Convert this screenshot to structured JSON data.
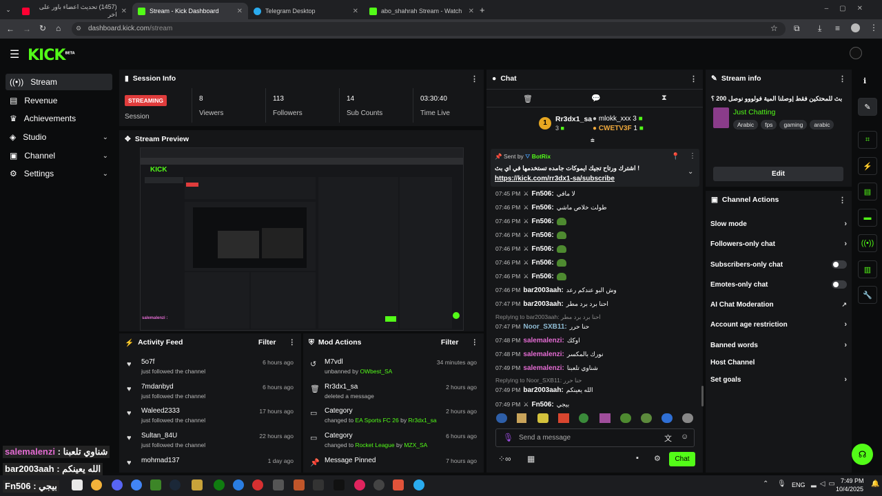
{
  "browser": {
    "tabs": [
      {
        "title": "(1457) تحديث اعضاء باور على اخر",
        "fav_color": "#ff0033"
      },
      {
        "title": "Stream - Kick Dashboard",
        "fav_color": "#53fc18"
      },
      {
        "title": "Telegram Desktop",
        "fav_color": "#2aabee"
      },
      {
        "title": "abo_shahrah Stream - Watch Li",
        "fav_color": "#53fc18"
      }
    ],
    "url_host": "dashboard.kick.com",
    "url_path": "/stream"
  },
  "header": {
    "logo": "KICK",
    "logo_badge": "BETA"
  },
  "sidebar": {
    "items": [
      {
        "label": "Stream",
        "icon": "broadcast-icon"
      },
      {
        "label": "Revenue",
        "icon": "revenue-icon"
      },
      {
        "label": "Achievements",
        "icon": "trophy-icon"
      },
      {
        "label": "Studio",
        "icon": "studio-icon"
      },
      {
        "label": "Channel",
        "icon": "channel-icon"
      },
      {
        "label": "Settings",
        "icon": "gear-icon"
      }
    ]
  },
  "session": {
    "title": "Session Info",
    "status_badge": "STREAMING",
    "status_label": "Session",
    "stats": [
      {
        "value": "8",
        "label": "Viewers"
      },
      {
        "value": "113",
        "label": "Followers"
      },
      {
        "value": "14",
        "label": "Sub Counts"
      },
      {
        "value": "03:30:40",
        "label": "Time Live"
      }
    ]
  },
  "preview": {
    "title": "Stream Preview"
  },
  "activity": {
    "title": "Activity Feed",
    "filter": "Filter",
    "items": [
      {
        "name": "5o7f",
        "desc": "just followed the channel",
        "time": "6 hours ago"
      },
      {
        "name": "7mdanbyd",
        "desc": "just followed the channel",
        "time": "6 hours ago"
      },
      {
        "name": "Waleed2333",
        "desc": "just followed the channel",
        "time": "17 hours ago"
      },
      {
        "name": "Sultan_84U",
        "desc": "just followed the channel",
        "time": "22 hours ago"
      },
      {
        "name": "mohmad137",
        "desc": "",
        "time": "1 day ago"
      }
    ]
  },
  "mod": {
    "title": "Mod Actions",
    "filter": "Filter",
    "items": [
      {
        "name": "M7vdl",
        "desc_pre": "unbanned by ",
        "desc_hl": "OWbest_SA",
        "desc_mid": "",
        "desc_hl2": "",
        "time": "34 minutes ago"
      },
      {
        "name": "Rr3dx1_sa",
        "desc_pre": "deleted a message",
        "desc_hl": "",
        "desc_mid": "",
        "desc_hl2": "",
        "time": "2 hours ago"
      },
      {
        "name": "Category",
        "desc_pre": "changed to ",
        "desc_hl": "EA Sports FC 26",
        "desc_mid": " by ",
        "desc_hl2": "Rr3dx1_sa",
        "time": "2 hours ago"
      },
      {
        "name": "Category",
        "desc_pre": "changed to ",
        "desc_hl": "Rocket League",
        "desc_mid": " by ",
        "desc_hl2": "MZX_SA",
        "time": "6 hours ago"
      },
      {
        "name": "Message Pinned",
        "desc_pre": "",
        "desc_hl": "",
        "desc_mid": "",
        "desc_hl2": "",
        "time": "7 hours ago"
      }
    ]
  },
  "chat": {
    "title": "Chat",
    "leaders": [
      {
        "rank": "1",
        "name": "Rr3dx1_sa",
        "count": "3"
      },
      {
        "name": "mlokk_xxx",
        "count": "3"
      },
      {
        "name": "CWETV3F",
        "count": "1"
      }
    ],
    "pinned": {
      "sent_by": "Sent by",
      "sender": "BotRix",
      "text": "! اشترك ورتاح تجيك ايموكات جامده تستخدمها في اي بث",
      "link": "https://kick.com/rr3dx1-sa/subscribe"
    },
    "messages": [
      {
        "time": "07:45 PM",
        "user": "Fn506:",
        "text": "لا مافي",
        "color": "#ffffff"
      },
      {
        "time": "07:46 PM",
        "user": "Fn506:",
        "text": "طولت خلاص ماشي",
        "color": "#ffffff"
      },
      {
        "time": "07:46 PM",
        "user": "Fn506:",
        "text": "",
        "color": "#ffffff",
        "emote": true
      },
      {
        "time": "07:46 PM",
        "user": "Fn506:",
        "text": "",
        "color": "#ffffff",
        "emote": true
      },
      {
        "time": "07:46 PM",
        "user": "Fn506:",
        "text": "",
        "color": "#ffffff",
        "emote": true
      },
      {
        "time": "07:46 PM",
        "user": "Fn506:",
        "text": "",
        "color": "#ffffff",
        "emote": true
      },
      {
        "time": "07:46 PM",
        "user": "Fn506:",
        "text": "",
        "color": "#ffffff",
        "emote": true
      },
      {
        "time": "07:46 PM",
        "user": "bar2003aah:",
        "text": "وش البو عندكم رعد",
        "color": "#ffffff"
      },
      {
        "time": "07:47 PM",
        "user": "bar2003aah:",
        "text": "احنا برد برد مطر",
        "color": "#ffffff"
      },
      {
        "time": "07:47 PM",
        "user": "Noor_SXB11:",
        "text": "حنا حرر",
        "color": "#8fbcd4",
        "reply": "Replying to bar2003aah: احنا برد برد مطر"
      },
      {
        "time": "07:48 PM",
        "user": "salemalenzi:",
        "text": "اوكك",
        "color": "#e36bd2"
      },
      {
        "time": "07:48 PM",
        "user": "salemalenzi:",
        "text": "نورك بالمكسر",
        "color": "#e36bd2"
      },
      {
        "time": "07:49 PM",
        "user": "salemalenzi:",
        "text": "شناوي تلعبنا",
        "color": "#e36bd2"
      },
      {
        "time": "07:49 PM",
        "user": "bar2003aah:",
        "text": "الله يعينكم",
        "color": "#ffffff",
        "reply": "Replying to Noor_SXB11: حنا حرر"
      },
      {
        "time": "07:49 PM",
        "user": "Fn506:",
        "text": "بيجي",
        "color": "#ffffff"
      }
    ],
    "input_placeholder": "Send a message",
    "send_label": "Chat"
  },
  "stream_info": {
    "title": "Stream info",
    "stream_title": "بث للمحتكين فقط |وصلنا المية فولووو نوصل 200 ؟",
    "category": "Just Chatting",
    "tags": [
      "Arabic",
      "fps",
      "gaming",
      "arabic"
    ],
    "edit_label": "Edit"
  },
  "channel_actions": {
    "title": "Channel Actions",
    "items": [
      {
        "label": "Slow mode",
        "control": "arrow"
      },
      {
        "label": "Followers-only chat",
        "control": "arrow"
      },
      {
        "label": "Subscribers-only chat",
        "control": "toggle"
      },
      {
        "label": "Emotes-only chat",
        "control": "toggle"
      },
      {
        "label": "AI Chat Moderation",
        "control": "external"
      },
      {
        "label": "Account age restriction",
        "control": "arrow"
      },
      {
        "label": "Banned words",
        "control": "arrow"
      },
      {
        "label": "Host Channel",
        "control": "none"
      },
      {
        "label": "Set goals",
        "control": "arrow"
      }
    ]
  },
  "overlay": {
    "lines": [
      {
        "user": "salemalenzi",
        "text": ": شناوي تلعبنا"
      },
      {
        "user": "bar2003aah",
        "text": ": الله يعينكم"
      },
      {
        "user": "Fn506",
        "text": ": بيجي"
      }
    ]
  },
  "taskbar": {
    "lang": "ENG",
    "time": "7:49 PM",
    "date": "10/4/2025"
  },
  "colors": {
    "accent": "#53fc18",
    "streaming": "#e03c3c",
    "panel": "#151618"
  }
}
